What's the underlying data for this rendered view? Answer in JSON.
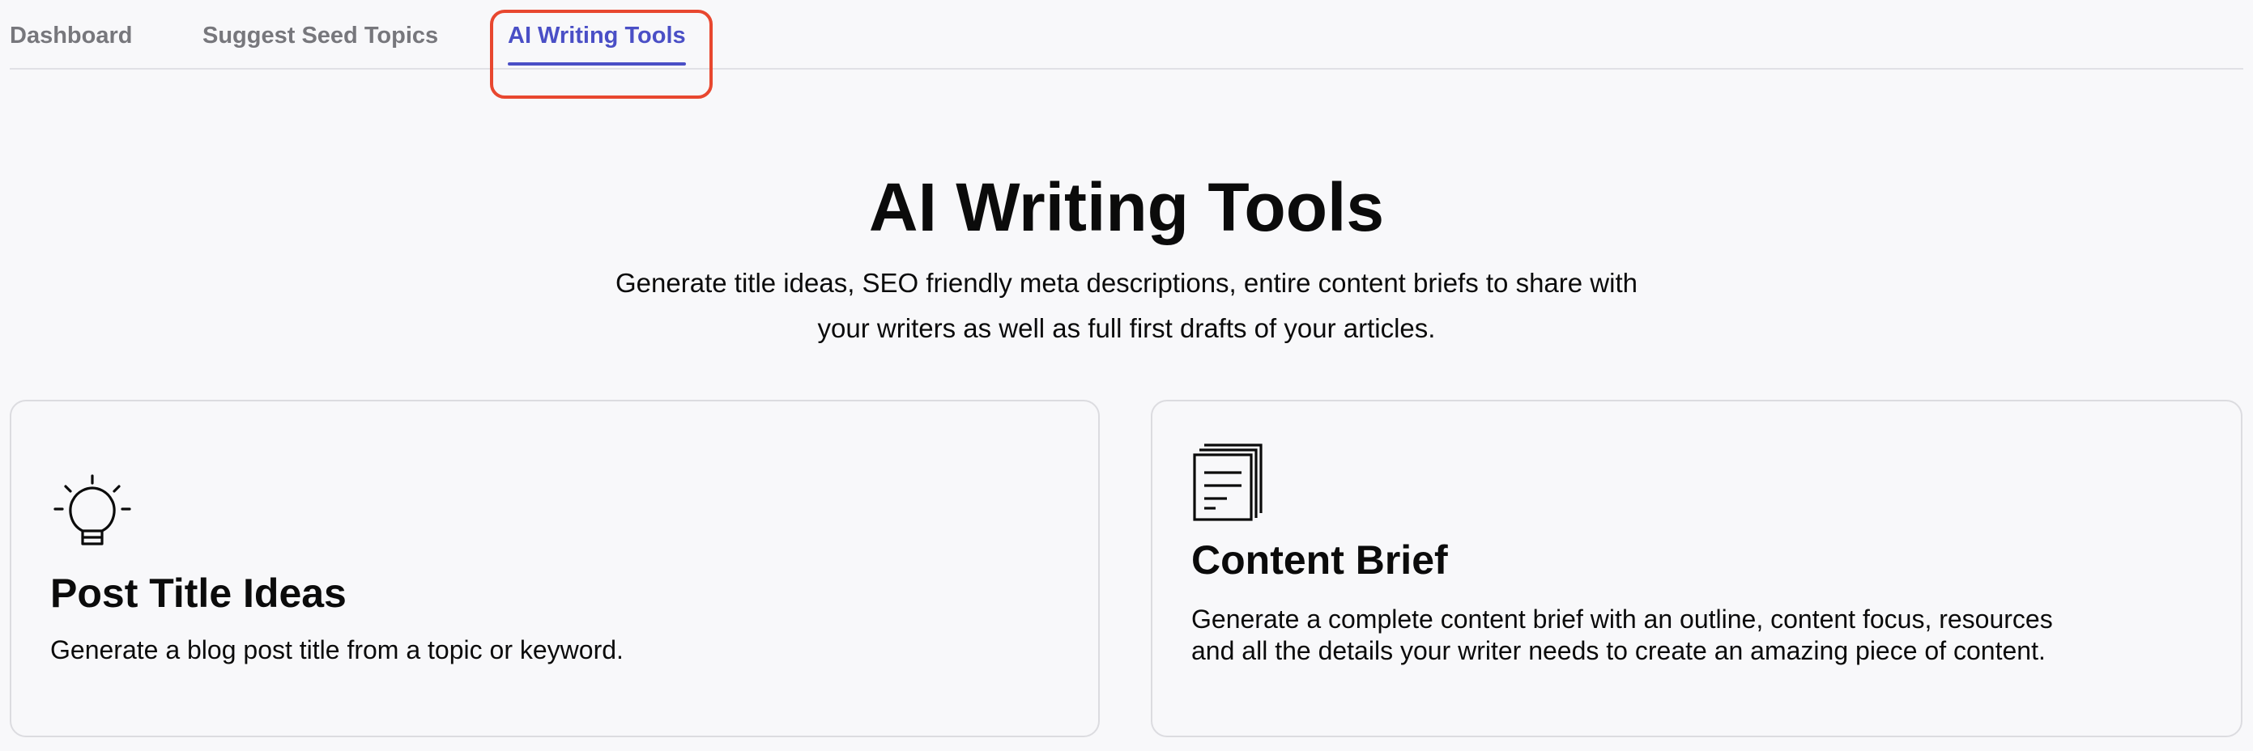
{
  "tabs": [
    {
      "label": "Dashboard"
    },
    {
      "label": "Suggest Seed Topics"
    },
    {
      "label": "AI Writing Tools",
      "active": true
    }
  ],
  "colors": {
    "accent": "#4a4fc6",
    "highlight_border": "#e8472f",
    "background": "#f8f8fa",
    "text": "#0b0b0b",
    "inactive_tab": "#77777c"
  },
  "hero": {
    "title": "AI Writing Tools",
    "subtitle": "Generate title ideas, SEO friendly meta descriptions, entire content briefs to share with your writers as well as full first drafts of your articles."
  },
  "cards": [
    {
      "icon": "lightbulb-icon",
      "title": "Post Title Ideas",
      "description": "Generate a blog post title from a topic or keyword."
    },
    {
      "icon": "document-icon",
      "title": "Content Brief",
      "description": "Generate a complete content brief with an outline, content focus, resources and all the details your writer needs to create an amazing piece of content."
    }
  ]
}
